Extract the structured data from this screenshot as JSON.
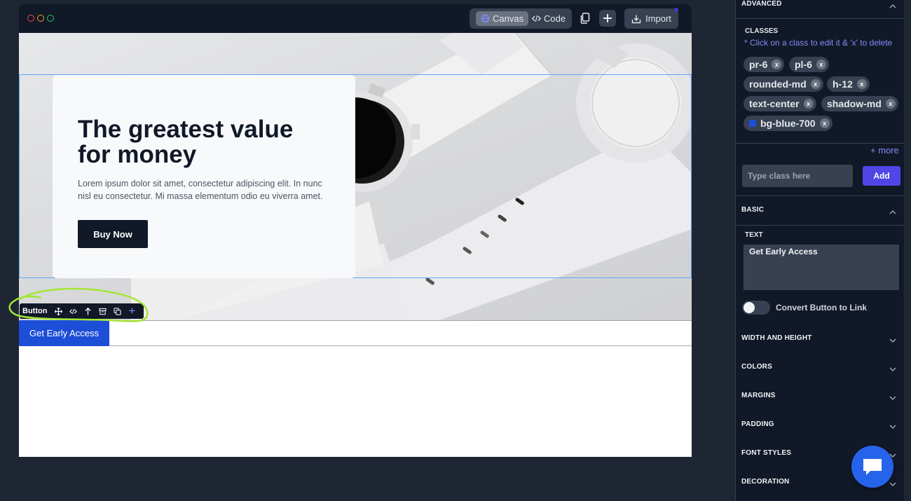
{
  "topbar": {
    "canvas_label": "Canvas",
    "code_label": "Code",
    "import_label": "Import"
  },
  "hero": {
    "title": "The greatest value for money",
    "body": "Lorem ipsum dolor sit amet, consectetur adipiscing elit. In nunc nisl eu consectetur. Mi massa elementum odio eu viverra amet.",
    "cta_label": "Buy Now"
  },
  "selected_button": {
    "label": "Get Early Access"
  },
  "element_toolbar": {
    "name": "Button",
    "icons": [
      "move-icon",
      "code-icon",
      "arrow-up-icon",
      "archive-icon",
      "duplicate-icon",
      "plus-icon"
    ]
  },
  "panel": {
    "advanced": "ADVANCED",
    "classes_label": "CLASSES",
    "classes_hint": "* Click on a class to edit it & 'x' to delete",
    "classes": [
      "pr-6",
      "pl-6",
      "rounded-md",
      "h-12",
      "text-center",
      "shadow-md",
      "bg-blue-700"
    ],
    "more_label": "+ more",
    "input_placeholder": "Type class here",
    "add_label": "Add",
    "basic": "BASIC",
    "text_label": "TEXT",
    "text_value": "Get Early Access",
    "convert_label": "Convert Button to Link",
    "sections": [
      "WIDTH AND HEIGHT",
      "COLORS",
      "MARGINS",
      "PADDING",
      "FONT STYLES",
      "DECORATION"
    ]
  },
  "colors": {
    "accent": "#4f46e5",
    "button_blue": "#1d4ed8",
    "annotation": "#a3e635"
  }
}
